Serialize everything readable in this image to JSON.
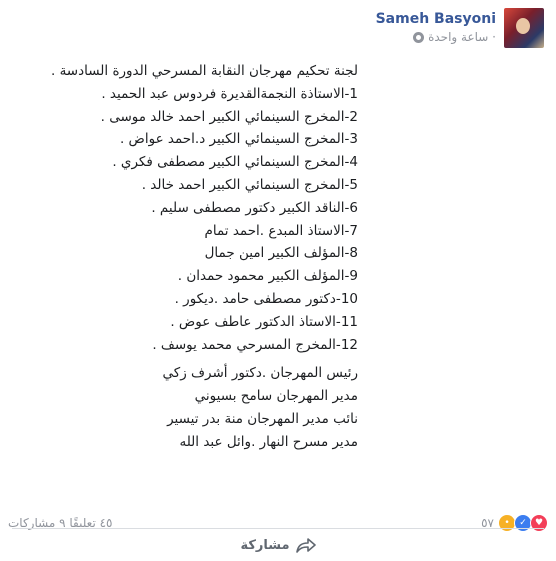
{
  "header": {
    "author": "Sameh Basyoni",
    "timestamp": "ساعة واحدة ·"
  },
  "post": {
    "lines": [
      "لجنة تحكيم مهرجان النقابة المسرحي الدورة السادسة .",
      "1-الاستاذة النجمةالقديرة فردوس عبد الحميد .",
      "2-المخرج السينمائي الكبير احمد خالد موسى .",
      "3-المخرج السينمائي الكبير د.احمد عواض .",
      "4-المخرج السينمائي الكبير مصطفى فكري .",
      "5-المخرج السينمائي الكبير احمد خالد .",
      "6-الناقد الكبير دكتور مصطفى سليم .",
      "7-الاستاذ المبدع .احمد تمام",
      "8-المؤلف الكبير امين جمال",
      "9-المؤلف الكبير محمود حمدان .",
      "10-دكتور مصطفى حامد .ديكور .",
      "11-الاستاذ الدكتور عاطف عوض .",
      "12-المخرج المسرحي محمد يوسف ."
    ],
    "staff": [
      "رئيس المهرجان .دكتور أشرف زكي",
      "مدير المهرجان سامح بسيوني",
      "نائب مدير المهرجان منة بدر تيسير",
      "مدير مسرح النهار .وائل عبد الله"
    ]
  },
  "stats": {
    "comments_shares": "٤٥ تعليقًا ٩ مشاركات",
    "reaction_count": "٥٧",
    "reaction_icons": [
      "love-icon",
      "like-icon",
      "wow-icon"
    ],
    "reaction_colors": {
      "love": "#f33e58",
      "like": "#3b7df0",
      "wow": "#f7b125"
    }
  },
  "actions": {
    "share_label": "مشاركة"
  },
  "colors": {
    "author": "#385898",
    "meta": "#90949c"
  }
}
